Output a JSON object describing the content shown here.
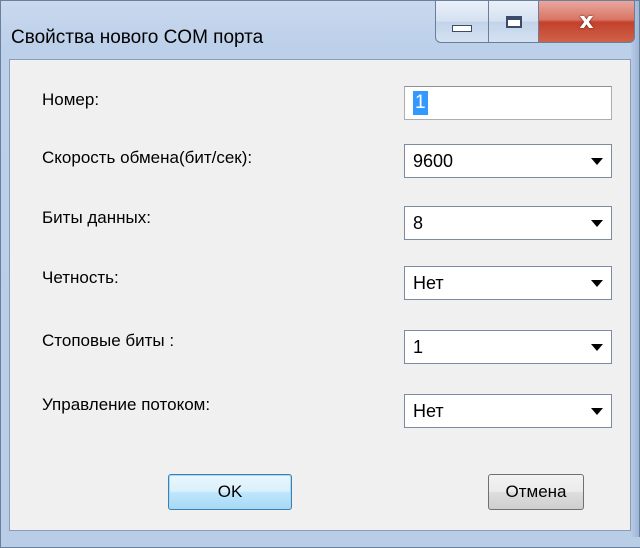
{
  "window": {
    "title": "Свойства нового COM порта",
    "close_symbol": "x"
  },
  "form": {
    "number_label": "Номер:",
    "number_value": "1",
    "speed_label": "Скорость обмена(бит/сек):",
    "speed_value": "9600",
    "databits_label": "Биты данных:",
    "databits_value": "8",
    "parity_label": "Четность:",
    "parity_value": "Нет",
    "stopbits_label": "Стоповые биты :",
    "stopbits_value": "1",
    "flow_label": "Управление потоком:",
    "flow_value": "Нет"
  },
  "buttons": {
    "ok_label": "OK",
    "cancel_label": "Отмена"
  },
  "colors": {
    "selection": "#3399ff",
    "close_button": "#c2412b"
  }
}
